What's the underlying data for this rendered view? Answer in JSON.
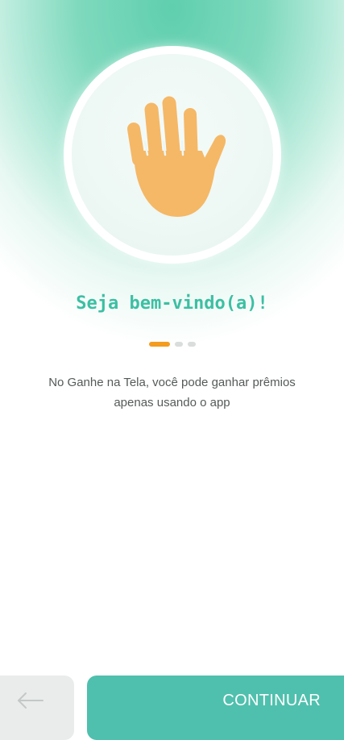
{
  "welcome": {
    "title": "Seja bem-vindo(a)!",
    "description": "No Ganhe na Tela, você pode ganhar prêmios apenas usando o app"
  },
  "hero": {
    "icon": "waving-hand-icon"
  },
  "pager": {
    "total": 3,
    "active_index": 0
  },
  "navigation": {
    "back_icon": "arrow-left-icon",
    "continue_label": "CONTINUAR"
  },
  "colors": {
    "accent_green": "#4fc0ad",
    "title_green": "#3cbfa3",
    "pager_active": "#f39c1f",
    "hand": "#f5b867"
  }
}
